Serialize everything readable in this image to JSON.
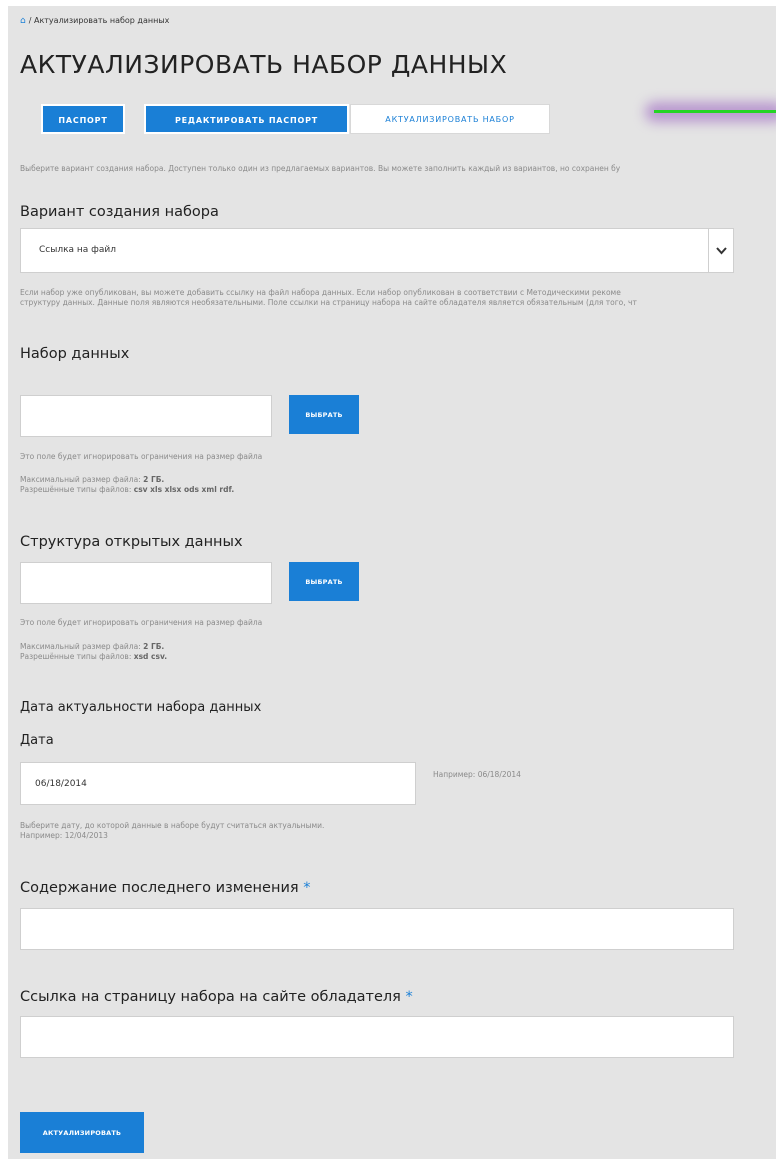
{
  "breadcrumb": {
    "separator": "/",
    "current": "Актуализировать набор данных"
  },
  "page_title": "АКТУАЛИЗИРОВАТЬ НАБОР ДАННЫХ",
  "tabs": [
    {
      "label": "ПАСПОРТ"
    },
    {
      "label": "РЕДАКТИРОВАТЬ ПАСПОРТ"
    },
    {
      "label": "АКТУАЛИЗИРОВАТЬ НАБОР"
    }
  ],
  "intro_hint": "Выберите вариант создания набора. Доступен только один из предлагаемых вариантов. Вы можете заполнить каждый из вариантов, но сохранен бу",
  "variant": {
    "label": "Вариант создания набора",
    "selected": "Ссылка на файл",
    "hint_line1": "Если набор уже опубликован, вы можете добавить ссылку на файл набора данных. Если набор опубликован в соответствии с Методическими рекоме",
    "hint_line2": "структуру данных. Данные поля являются необязательными. Поле ссылки на страницу набора на сайте обладателя является обязательным (для того, чт"
  },
  "dataset": {
    "label": "Набор данных",
    "button": "ВЫБРАТЬ",
    "hint_ignore": "Это поле будет игнорировать ограничения на размер файла",
    "max_size_label": "Максимальный размер файла:",
    "max_size_value": "2 ГБ.",
    "allowed_label": "Разрешённые типы файлов:",
    "allowed_value": "csv xls xlsx ods xml rdf."
  },
  "structure": {
    "label": "Структура открытых данных",
    "button": "ВЫБРАТЬ",
    "hint_ignore": "Это поле будет игнорировать ограничения на размер файла",
    "max_size_label": "Максимальный размер файла:",
    "max_size_value": "2 ГБ.",
    "allowed_label": "Разрешённые типы файлов:",
    "allowed_value": "xsd csv."
  },
  "date_section": {
    "label": "Дата актуальности набора данных",
    "date_label": "Дата",
    "date_value": "06/18/2014",
    "example_side": "Например: 06/18/2014",
    "hint_line1": "Выберите дату, до которой данные в наборе будут считаться актуальными.",
    "hint_line2": "Например: 12/04/2013"
  },
  "last_change": {
    "label": "Содержание последнего изменения",
    "required_mark": "*",
    "value": ""
  },
  "owner_link": {
    "label": "Ссылка на страницу набора на сайте обладателя",
    "required_mark": "*",
    "value": ""
  },
  "submit": {
    "label": "АКТУАЛИЗИРОВАТЬ"
  },
  "colors": {
    "accent": "#1a7fd6",
    "background": "#e4e4e4",
    "highlight_line": "#25d425",
    "highlight_glow": "#965abe"
  }
}
